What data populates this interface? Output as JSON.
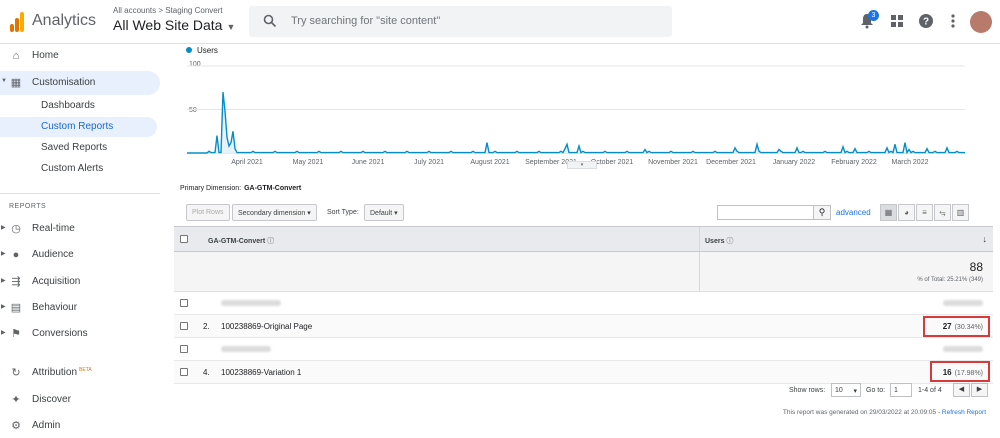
{
  "header": {
    "app_name": "Analytics",
    "breadcrumb": "All accounts > Staging Convert",
    "property": "All Web Site Data",
    "search_placeholder": "Try searching for \"site content\"",
    "notification_count": "3",
    "logo_colors": [
      "#f9ab00",
      "#e37400",
      "#e37400"
    ]
  },
  "sidebar": {
    "home": "Home",
    "customisation": "Customisation",
    "sub_items": [
      "Dashboards",
      "Custom Reports",
      "Saved Reports",
      "Custom Alerts"
    ],
    "reports_heading": "REPORTS",
    "reports": [
      "Real-time",
      "Audience",
      "Acquisition",
      "Behaviour",
      "Conversions"
    ],
    "attribution": "Attribution",
    "attribution_badge": "BETA",
    "discover": "Discover",
    "admin": "Admin"
  },
  "chart_data": {
    "type": "line",
    "series": [
      {
        "name": "Users",
        "color": "#058dc7"
      }
    ],
    "y_ticks": [
      "100",
      "50"
    ],
    "ylim": [
      0,
      100
    ],
    "x_labels": [
      "April 2021",
      "May 2021",
      "June 2021",
      "July 2021",
      "August 2021",
      "September 2021",
      "October 2021",
      "November 2021",
      "December 2021",
      "January 2022",
      "February 2022",
      "March 2022"
    ],
    "grid": true
  },
  "report": {
    "primary_dimension_label": "Primary Dimension:",
    "primary_dimension": "GA-GTM-Convert",
    "plot_rows": "Plot Rows",
    "secondary_dimension": "Secondary dimension",
    "sort_type_label": "Sort Type:",
    "sort_type": "Default",
    "advanced": "advanced",
    "col_dimension": "GA-GTM-Convert",
    "col_metric": "Users",
    "total": "88",
    "total_sub": "% of Total: 25.21% (349)",
    "rows": [
      {
        "num": "2.",
        "label": "100238869-Original Page",
        "value": "27",
        "pct": "(30.34%)"
      },
      {
        "num": "4.",
        "label": "100238869-Variation 1",
        "value": "16",
        "pct": "(17.98%)"
      }
    ],
    "show_rows_label": "Show rows:",
    "show_rows": "10",
    "goto_label": "Go to:",
    "goto_value": "1",
    "range": "1-4 of 4",
    "footer": "This report was generated on 29/03/2022 at 20:09:05 - ",
    "refresh": "Refresh Report"
  }
}
